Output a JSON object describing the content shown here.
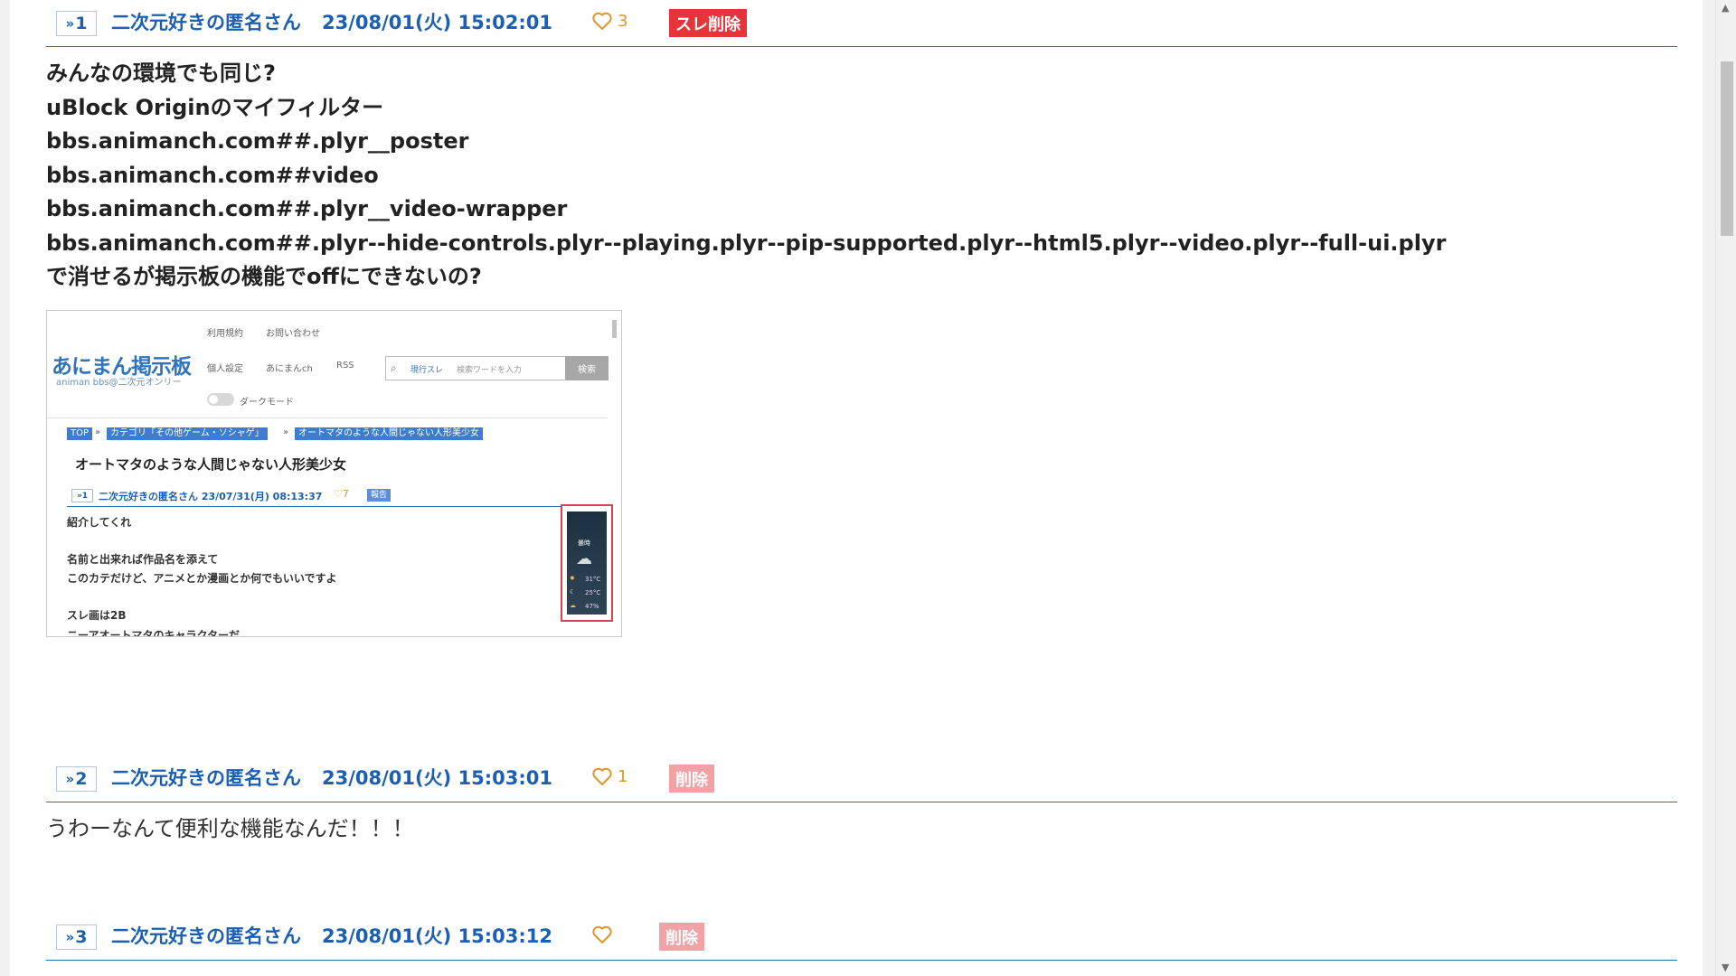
{
  "posts": [
    {
      "num": "1",
      "author": "二次元好きの匿名さん",
      "date": "23/08/01(火) 15:02:01",
      "likes": "3",
      "delete_label": "スレ削除",
      "lines": [
        "みんなの環境でも同じ?",
        "uBlock Originのマイフィルター",
        "bbs.animanch.com##.plyr__poster",
        "bbs.animanch.com##video",
        "bbs.animanch.com##.plyr__video-wrapper",
        "bbs.animanch.com##.plyr--hide-controls.plyr--playing.plyr--pip-supported.plyr--html5.plyr--video.plyr--full-ui.plyr",
        "で消せるが掲示板の機能でoffにできないの?"
      ],
      "screenshot": {
        "logo": "あにまん掲示板",
        "logo_sub": "animan bbs@二次元オンリー",
        "top_links": [
          "利用規約",
          "お問い合わせ"
        ],
        "nav_links": [
          "個人設定",
          "あにまんch",
          "RSS"
        ],
        "search_scope": "現行スレ",
        "search_placeholder": "検索ワードを入力",
        "search_button": "検索",
        "dark_mode": "ダークモード",
        "breadcrumb": [
          "TOP",
          "カテゴリ「その他ゲーム・ソシャゲ」",
          "オートマタのような人間じゃない人形美少女"
        ],
        "breadcrumb_sep": "»",
        "title": "オートマタのような人間じゃない人形美少女",
        "post_num": "1",
        "post_meta": "二次元好きの匿名さん  23/07/31(月) 08:13:37",
        "post_likes": "7",
        "post_report": "報告",
        "post_lines": [
          "紹介してくれ",
          "名前と出来れば作品名を添えて",
          "このカテだけど、アニメとか漫画とか何でもいいですよ",
          "スレ画は2B",
          "ニーアオートマタのキャラクターだ"
        ],
        "ad_text": [
          "曇時",
          "31°C",
          "25°C",
          "47%"
        ]
      }
    },
    {
      "num": "2",
      "author": "二次元好きの匿名さん",
      "date": "23/08/01(火) 15:03:01",
      "likes": "1",
      "delete_label": "削除",
      "text": "うわーなんて便利な機能なんだ！！！"
    },
    {
      "num": "3",
      "author": "二次元好きの匿名さん",
      "date": "23/08/01(火) 15:03:12",
      "likes": "",
      "delete_label": "削除"
    }
  ],
  "icons": {
    "res_arrow": "double-chevron-right-icon",
    "like": "heart-icon"
  },
  "colors": {
    "link_blue": "#1a5fb4",
    "like_orange": "#e1952a",
    "delete_red": "#e6353a",
    "delete_pink": "#f2a1a4"
  }
}
